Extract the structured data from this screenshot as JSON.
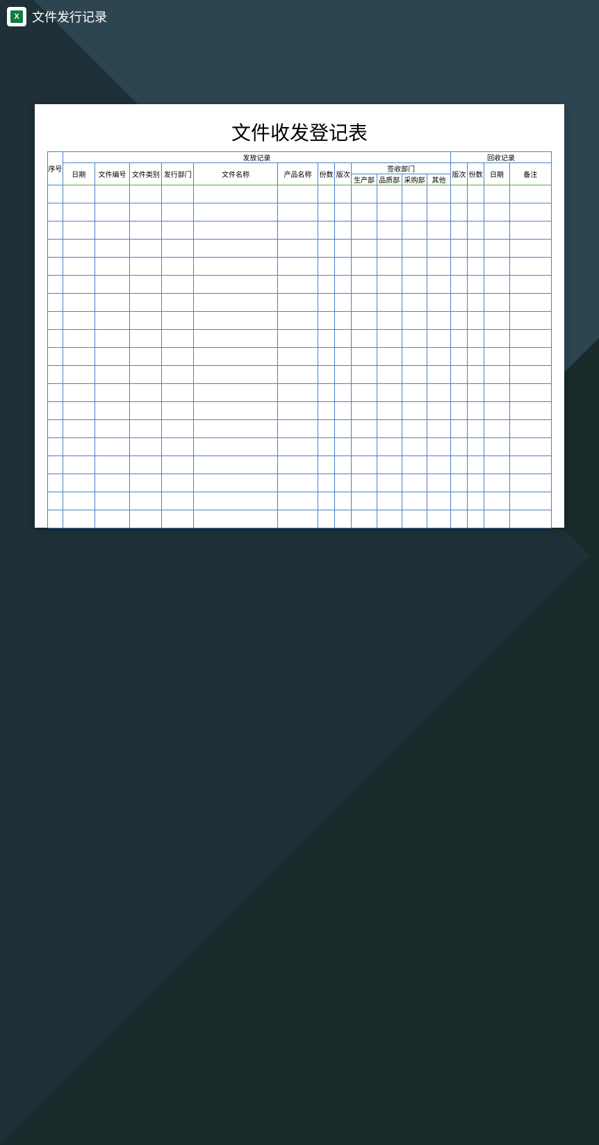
{
  "header": {
    "icon_label": "X",
    "title": "文件发行记录"
  },
  "document": {
    "title": "文件收发登记表",
    "sections": {
      "issue": "发放记录",
      "recycle": "回收记录",
      "signoff": "签收部门"
    },
    "columns": {
      "seq": "序号",
      "date": "日期",
      "doc_no": "文件编号",
      "doc_type": "文件类别",
      "issue_dept": "发行部门",
      "doc_name": "文件名称",
      "prod_name": "产品名称",
      "copies": "份数",
      "version": "版次",
      "dept_prod": "生产部",
      "dept_quality": "品质部",
      "dept_purchase": "采购部",
      "dept_other": "其他",
      "r_version": "版次",
      "r_copies": "份数",
      "r_date": "日期",
      "remark": "备注"
    },
    "data_rows": 19
  }
}
